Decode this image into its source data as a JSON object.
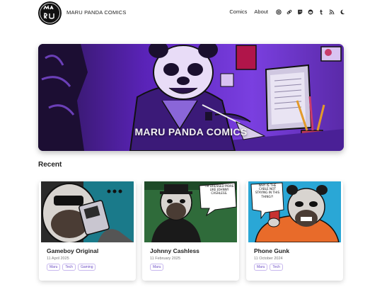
{
  "site": {
    "title": "MARU PANDA COMICS",
    "logo_text": "MARU"
  },
  "nav": {
    "links": [
      "Comics",
      "About"
    ],
    "icons": [
      "at-icon",
      "link-icon",
      "twitch-icon",
      "reddit-icon",
      "tumblr-icon",
      "rss-icon",
      "dark-mode-moon-icon"
    ]
  },
  "hero": {
    "title": "MARU PANDA COMICS"
  },
  "recent": {
    "heading": "Recent",
    "cards": [
      {
        "title": "Gameboy Original",
        "date": "11 April 2025",
        "tags": [
          "Maru",
          "Tech",
          "Gaming"
        ]
      },
      {
        "title": "Johnny Cashless",
        "date": "11 February 2025",
        "tags": [
          "Maru"
        ],
        "speech": "I'M DRESSED MORE LIKE JOHNNY CASHLESS."
      },
      {
        "title": "Phone Gunk",
        "date": "11 October 2024",
        "tags": [
          "Maru",
          "Tech"
        ],
        "speech": "WHY IS THE CABLE NOT STAYING IN THIS THING?!"
      }
    ]
  },
  "colors": {
    "accent": "#6a4bc4",
    "hero_purple": "#6b2fc7",
    "tag_border": "#c8b8ef"
  }
}
